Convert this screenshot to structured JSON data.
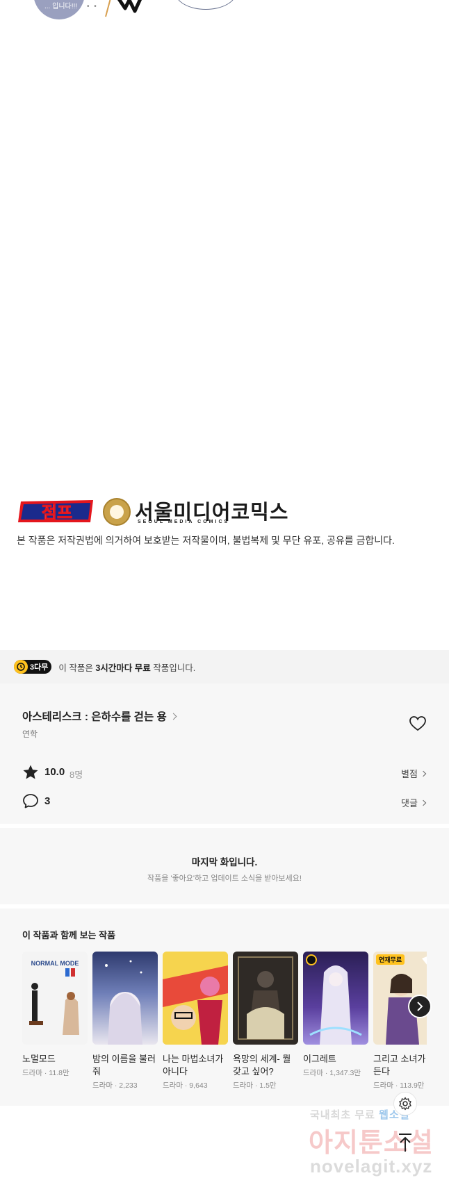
{
  "comic_top": {
    "bubble_text": "... 입니다!!!"
  },
  "publisher": {
    "logo_jump": "점프",
    "name": "서울미디어코믹스",
    "sub": "SEOUL MEDIA COMICS",
    "copyright": "본 작품은 저작권법에 의거하여 보호받는 저작물이며, 불법복제 및 무단 유포, 공유를 금합니다."
  },
  "free_banner": {
    "badge": "3다무",
    "text_prefix": "이 작품은 ",
    "text_bold": "3시간마다 무료",
    "text_suffix": " 작품입니다."
  },
  "work": {
    "title": "아스테리스크 : 은하수를 걷는 용",
    "author": "연학",
    "rating": "10.0",
    "rating_count": "8명",
    "rate_label": "별점",
    "comments": "3",
    "comments_label": "댓글"
  },
  "last_episode": {
    "title": "마지막 화입니다.",
    "subtitle": "작품을 '좋아요'하고 업데이트 소식을 받아보세요!"
  },
  "recommendations": {
    "title": "이 작품과 함께 보는 작품",
    "items": [
      {
        "title": "노멀모드",
        "meta": "드라마 · 11.8만",
        "thumb_text": "NORMAL MODE",
        "bg": "#f4f4f4"
      },
      {
        "title": "밤의 이름을 불러줘",
        "meta": "드라마 · 2,233",
        "thumb_text": "",
        "bg": "#3d4a7a"
      },
      {
        "title": "나는 마법소녀가 아니다",
        "meta": "드라마 · 9,643",
        "thumb_text": "",
        "bg": "#e85a4a"
      },
      {
        "title": "욕망의 세계- 뭘 갖고 싶어?",
        "meta": "드라마 · 1.5만",
        "thumb_text": "",
        "bg": "#3a3530"
      },
      {
        "title": "이그레트",
        "meta": "드라마 · 1,347.3만",
        "thumb_text": "",
        "bg": "#3b2f6e"
      },
      {
        "title": "그리고 소녀가 을 든다",
        "meta": "드라마 · 113.9만",
        "thumb_text": "",
        "bg": "#f0e2c8",
        "badge": "연재무료"
      }
    ]
  },
  "watermark": {
    "line1_a": "국내최초 무료",
    "line1_b": "웹소설",
    "line2": "아지툰소설",
    "line3": "novelagit.xyz"
  }
}
